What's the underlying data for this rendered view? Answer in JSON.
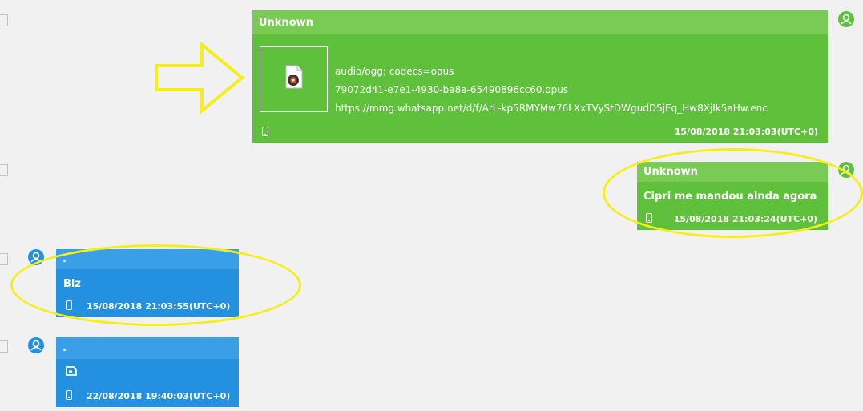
{
  "messages": [
    {
      "sender": "Unknown",
      "attachment": {
        "mime": "audio/ogg; codecs=opus",
        "filename": "79072d41-e7e1-4930-ba8a-65490896cc60.opus",
        "url": "https://mmg.whatsapp.net/d/f/ArL-kp5RMYMw76LXxTVyStDWgudD5jEq_Hw8XjIk5aHw.enc",
        "icon": "audio-file-icon"
      },
      "timestamp": "15/08/2018 21:03:03(UTC+0)"
    },
    {
      "sender": "Unknown",
      "text": "Cipri me mandou ainda agora",
      "timestamp": "15/08/2018 21:03:24(UTC+0)"
    },
    {
      "sender": ".",
      "text": "Blz",
      "timestamp": "15/08/2018 21:03:55(UTC+0)"
    },
    {
      "sender": ".",
      "icon": "sticker-icon",
      "timestamp": "22/08/2018 19:40:03(UTC+0)"
    }
  ],
  "colors": {
    "outgoing_bubble": "#5fc13b",
    "outgoing_header": "#79cb55",
    "incoming_bubble": "#2490e0",
    "incoming_header": "#3a9fe6",
    "annotation": "#f5ee1a"
  }
}
